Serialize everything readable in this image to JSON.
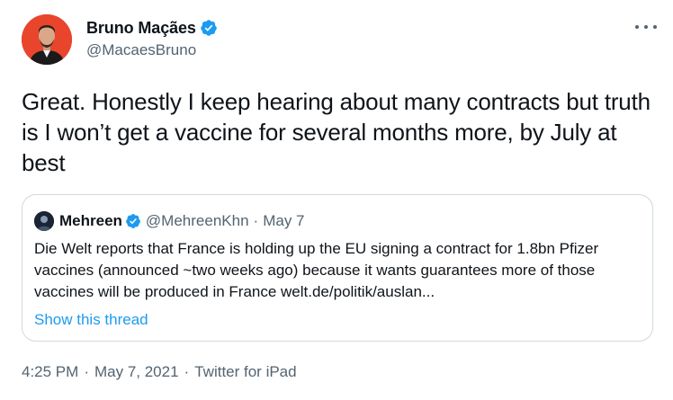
{
  "author": {
    "display_name": "Bruno Maçães",
    "handle": "@MacaesBruno",
    "verified": true
  },
  "tweet": {
    "text": "Great. Honestly I keep hearing about many contracts but truth is I won’t get a vaccine for several months more, by July at best"
  },
  "quoted": {
    "display_name": "Mehreen",
    "handle": "@MehreenKhn",
    "separator": "·",
    "date": "May 7",
    "text": "Die Welt reports that France is holding up the EU signing a contract for 1.8bn Pfizer vaccines (announced ~two weeks ago) because it wants guarantees more of those vaccines will be produced in France welt.de/politik/auslan...",
    "show_thread": "Show this thread"
  },
  "meta": {
    "time": "4:25 PM",
    "separator": "·",
    "date": "May 7, 2021",
    "source": "Twitter for iPad"
  },
  "icons": {
    "verified": "verified-badge-icon",
    "more": "more-options-icon"
  },
  "colors": {
    "accent": "#1d9bf0",
    "secondary_text": "#536471",
    "border": "#cfd9de",
    "avatar_bg": "#e8452c"
  }
}
